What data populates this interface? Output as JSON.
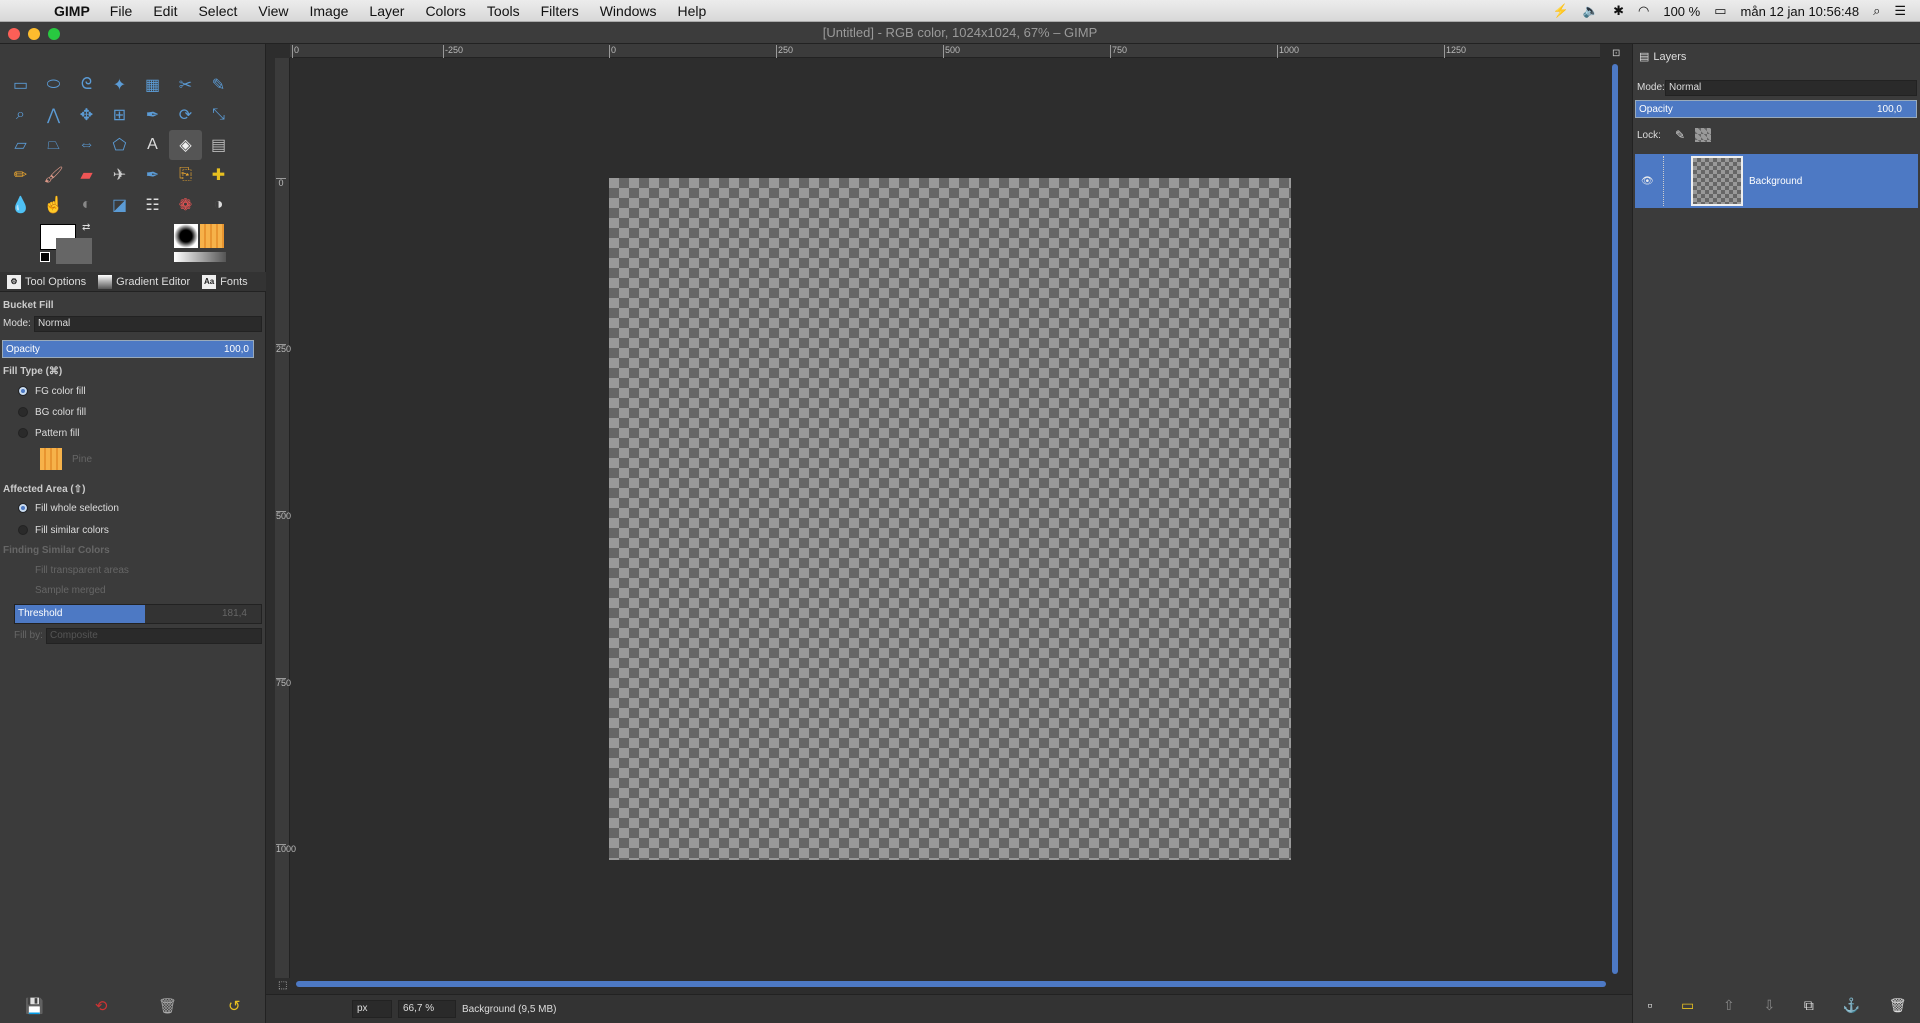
{
  "menubar": {
    "app": "GIMP",
    "items": [
      "File",
      "Edit",
      "Select",
      "View",
      "Image",
      "Layer",
      "Colors",
      "Tools",
      "Filters",
      "Windows",
      "Help"
    ],
    "battery": "100 %",
    "clock": "mån 12 jan  10:56:48"
  },
  "window": {
    "title": "[Untitled] - RGB color, 1024x1024, 67% – GIMP"
  },
  "tabs": {
    "tool_options": "Tool Options",
    "gradient_editor": "Gradient Editor",
    "fonts": "Fonts"
  },
  "tool_options": {
    "heading": "Bucket Fill",
    "mode_label": "Mode:",
    "mode_value": "Normal",
    "opacity_label": "Opacity",
    "opacity_value": "100,0",
    "fill_type_label": "Fill Type  (⌘)",
    "fill_fg": "FG color fill",
    "fill_bg": "BG color fill",
    "fill_pattern": "Pattern fill",
    "pattern_name": "Pine",
    "affected_label": "Affected Area  (⇧)",
    "affected_whole": "Fill whole selection",
    "affected_similar": "Fill similar colors",
    "finding_label": "Finding Similar Colors",
    "fill_transparent": "Fill transparent areas",
    "sample_merged": "Sample merged",
    "threshold_label": "Threshold",
    "threshold_value": "181,4",
    "fill_by_label": "Fill by:",
    "fill_by_value": "Composite",
    "threshold_fraction": 0.53
  },
  "rulers": {
    "h": [
      "0",
      "-250",
      "0",
      "250",
      "500",
      "750",
      "1000",
      "1250"
    ],
    "v": [
      "0",
      "250",
      "500",
      "750",
      "1000"
    ]
  },
  "status": {
    "unit": "px",
    "zoom": "66,7 %",
    "info": "Background (9,5 MB)"
  },
  "layers_dock": {
    "title": "Layers",
    "mode_label": "Mode:",
    "mode_value": "Normal",
    "opacity_label": "Opacity",
    "opacity_value": "100,0",
    "lock_label": "Lock:",
    "layer_name": "Background"
  }
}
